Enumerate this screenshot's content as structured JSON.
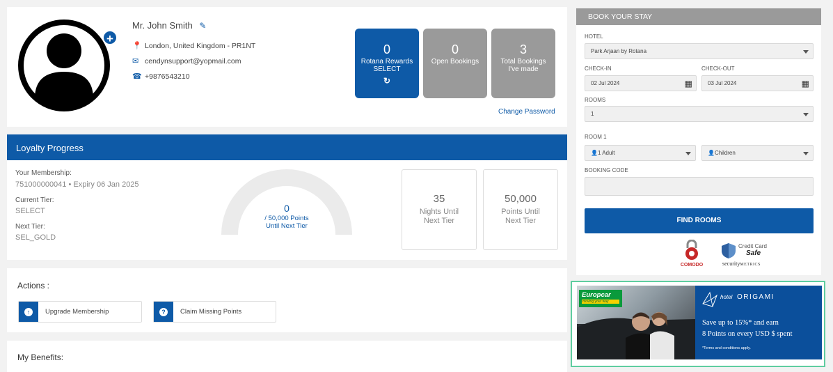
{
  "profile": {
    "name": "Mr. John Smith",
    "location": "London, United Kingdom - PR1NT",
    "email": "cendynsupport@yopmail.com",
    "phone": "+9876543210",
    "stats": [
      {
        "num": "0",
        "label1": "Rotana Rewards",
        "label2": "SELECT"
      },
      {
        "num": "0",
        "label1": "Open Bookings",
        "label2": ""
      },
      {
        "num": "3",
        "label1": "Total Bookings",
        "label2": "I've made"
      }
    ],
    "change_password": "Change Password"
  },
  "loyalty": {
    "title": "Loyalty Progress",
    "membership_label": "Your Membership:",
    "membership_value": "751000000041 • Expiry 06 Jan 2025",
    "tier_label": "Current Tier:",
    "tier_value": "SELECT",
    "next_label": "Next Tier:",
    "next_value": "SEL_GOLD",
    "gauge_points": "0",
    "gauge_line1": "/ 50,000 Points",
    "gauge_line2": "Until Next Tier",
    "gauge_progress": 0,
    "nights_num": "35",
    "nights_l1": "Nights Until",
    "nights_l2": "Next Tier",
    "points_num": "50,000",
    "points_l1": "Points Until",
    "points_l2": "Next Tier"
  },
  "actions": {
    "title": "Actions :",
    "upgrade": "Upgrade Membership",
    "claim": "Claim Missing Points"
  },
  "benefits": {
    "title": "My Benefits:"
  },
  "booking": {
    "title": "BOOK YOUR STAY",
    "hotel_label": "HOTEL",
    "hotel_value": "Park Arjaan by Rotana",
    "checkin_label": "CHECK-IN",
    "checkin_value": "02 Jul 2024",
    "checkout_label": "CHECK-OUT",
    "checkout_value": "03 Jul 2024",
    "rooms_label": "ROOMS",
    "rooms_value": "1",
    "room1_label": "ROOM 1",
    "adults_value": "1 Adult",
    "children_value": "Children",
    "code_label": "BOOKING CODE",
    "code_value": "",
    "find_button": "FIND ROOMS",
    "comodo": "COMODO",
    "cc_line1": "Credit Card",
    "cc_line2": "Safe",
    "securitymetrics_a": "security",
    "securitymetrics_b": "METRICS"
  },
  "ad": {
    "europcar": "Europcar",
    "europcar_tag": "moving your way",
    "hotel_prefix": "hotel",
    "hotel_brand": "ORIGAMI",
    "line1": "Save up to 15%* and earn",
    "line2": "8 Points on every USD $ spent",
    "terms": "*Terms and conditions apply."
  },
  "colors": {
    "primary": "#0e5aa7",
    "stat_gray": "#9a9a9a",
    "ad_blue": "#0b4f9b",
    "ad_border": "#5fcda0"
  }
}
